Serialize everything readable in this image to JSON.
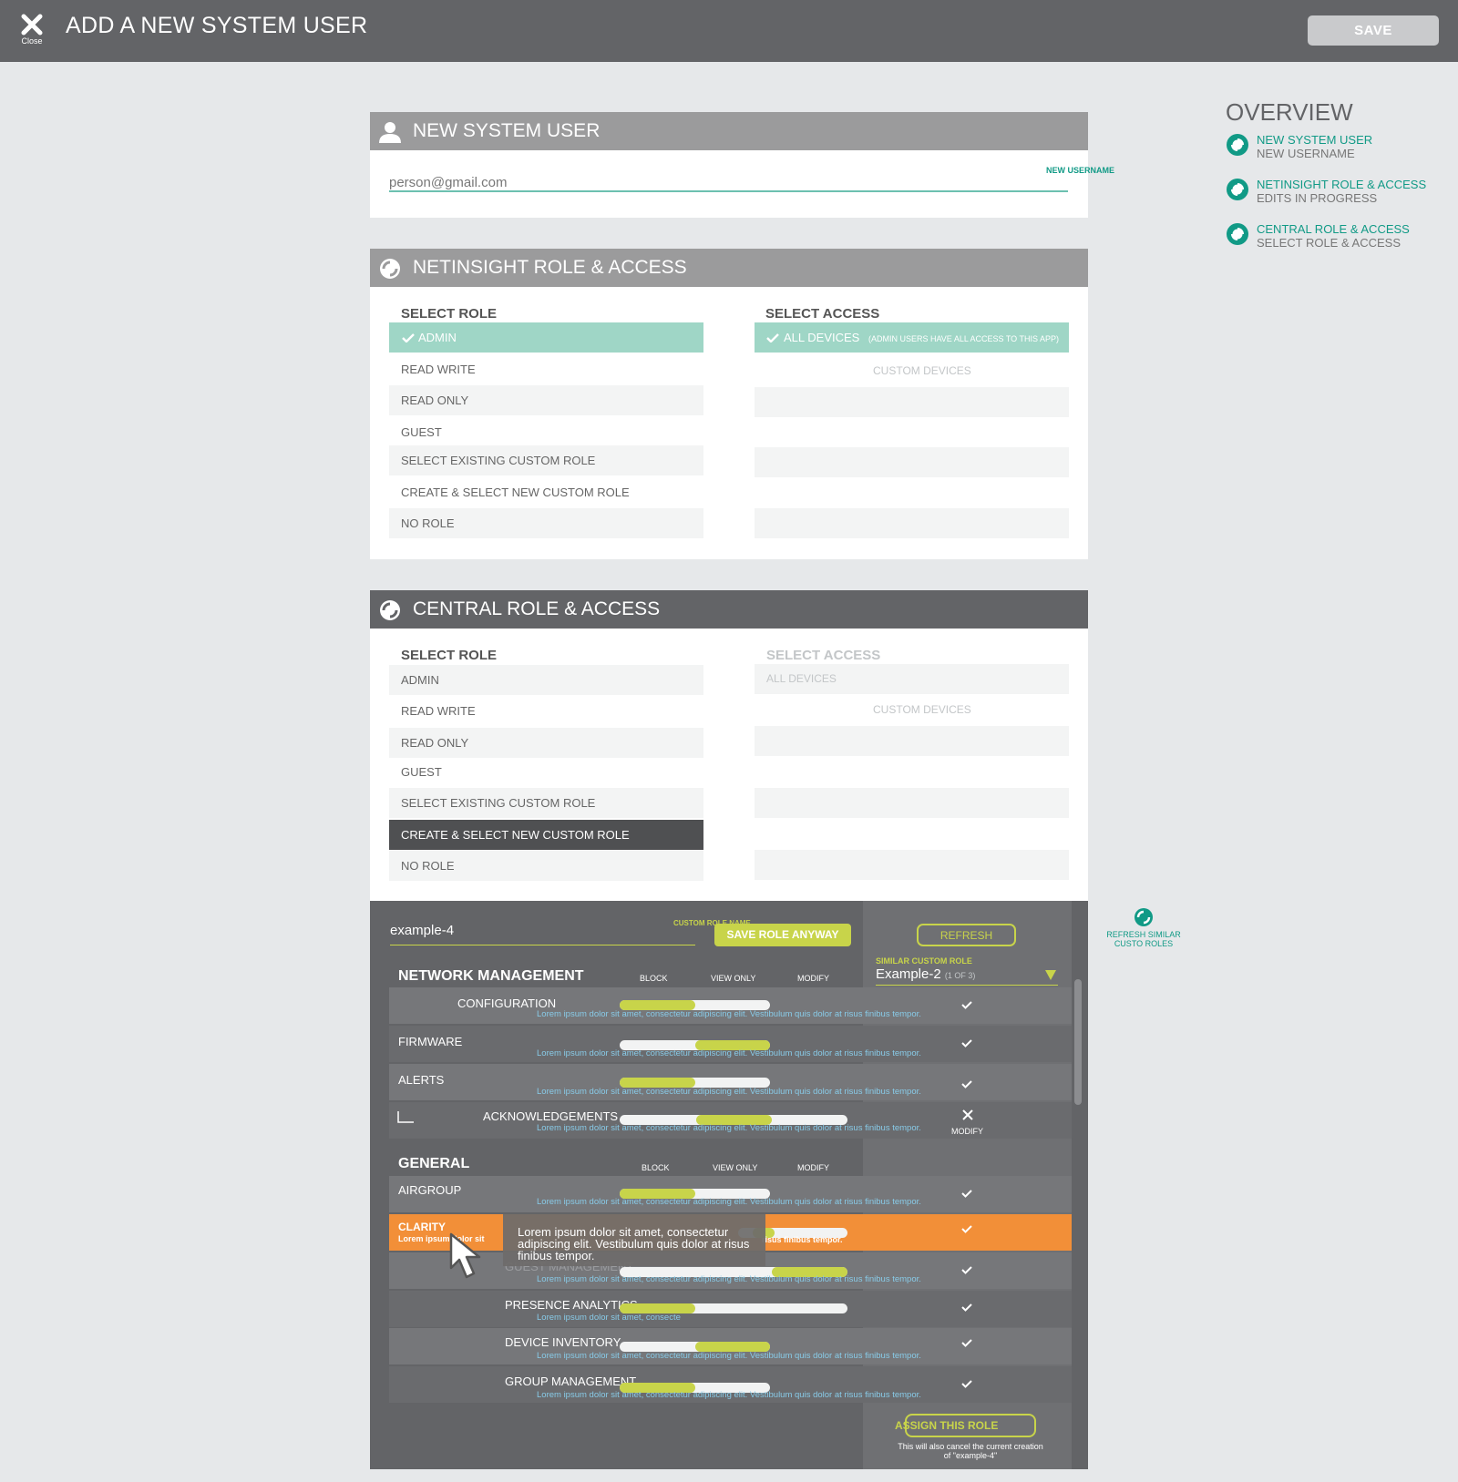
{
  "window": {
    "title": "ADD A NEW SYSTEM USER",
    "close_label": "Close",
    "save_label": "SAVE"
  },
  "new_user": {
    "title": "NEW SYSTEM USER",
    "email_value": "person@gmail.com",
    "field_label": "NEW USERNAME"
  },
  "netinsight": {
    "title": "NETINSIGHT ROLE & ACCESS",
    "select_role_label": "SELECT ROLE",
    "select_access_label": "SELECT ACCESS",
    "roles": [
      "ADMIN",
      "READ WRITE",
      "READ ONLY",
      "GUEST",
      "SELECT EXISTING CUSTOM ROLE",
      "CREATE & SELECT NEW CUSTOM ROLE",
      "NO ROLE"
    ],
    "access_all": "ALL DEVICES",
    "access_note": "(ADMIN USERS HAVE ALL ACCESS TO THIS APP)",
    "access_custom": "CUSTOM DEVICES"
  },
  "central": {
    "title": "CENTRAL ROLE & ACCESS",
    "select_role_label": "SELECT ROLE",
    "select_access_label": "SELECT ACCESS",
    "roles": [
      "ADMIN",
      "READ WRITE",
      "READ ONLY",
      "GUEST",
      "SELECT EXISTING CUSTOM ROLE",
      "CREATE & SELECT NEW CUSTOM ROLE",
      "NO ROLE"
    ],
    "access_all": "ALL DEVICES",
    "access_custom": "CUSTOM DEVICES"
  },
  "overview": {
    "title": "OVERVIEW",
    "items": [
      {
        "title": "NEW SYSTEM USER",
        "status": "NEW USERNAME"
      },
      {
        "title": "NETINSIGHT ROLE & ACCESS",
        "status": "EDITS IN PROGRESS"
      },
      {
        "title": "CENTRAL ROLE & ACCESS",
        "status": "SELECT ROLE & ACCESS"
      }
    ]
  },
  "custom_role": {
    "name_value": "example-4",
    "name_label": "CUSTOM ROLE NAME",
    "save_anyway": "SAVE ROLE ANYWAY",
    "refresh": "REFRESH",
    "similar_label": "SIMILAR CUSTOM ROLE",
    "similar_value": "Example-2",
    "similar_count": "(1 OF 3)",
    "refresh_side": "REFRESH SIMILAR CUSTO ROLES",
    "col_block": "BLOCK",
    "col_view": "VIEW ONLY",
    "col_modify": "MODIFY",
    "sec1": "NETWORK MANAGEMENT",
    "sec2": "GENERAL",
    "lorem": "Lorem ipsum dolor sit amet, consectetur adipiscing elit. Vestibulum quis dolor at risus finibus tempor.",
    "lorem_short": "Lorem ipsum dolor sit",
    "lorem_tail": "risus finibus tempor.",
    "lorem_mid": "Lorem ipsum dolor sit amet, consecte",
    "modify_label": "MODIFY",
    "rows": [
      "CONFIGURATION",
      "FIRMWARE",
      "ALERTS",
      "ACKNOWLEDGEMENTS",
      "AIRGROUP",
      "CLARITY",
      "GUEST MANAGEMENT",
      "PRESENCE ANALYTICS",
      "DEVICE INVENTORY",
      "GROUP MANAGEMENT"
    ],
    "tooltip": "Lorem ipsum dolor sit amet, consectetur adipiscing elit. Vestibulum quis dolor at risus finibus tempor.",
    "assign": "ASSIGN THIS ROLE",
    "assign_note": "This will also cancel the current creation of \"example-4\""
  },
  "colors": {
    "header_bg": "#636467",
    "accent_teal": "#119a86",
    "selected_role": "#9fd6c6",
    "slider_fill": "#c8d44a",
    "highlight_row": "#f28f38"
  }
}
